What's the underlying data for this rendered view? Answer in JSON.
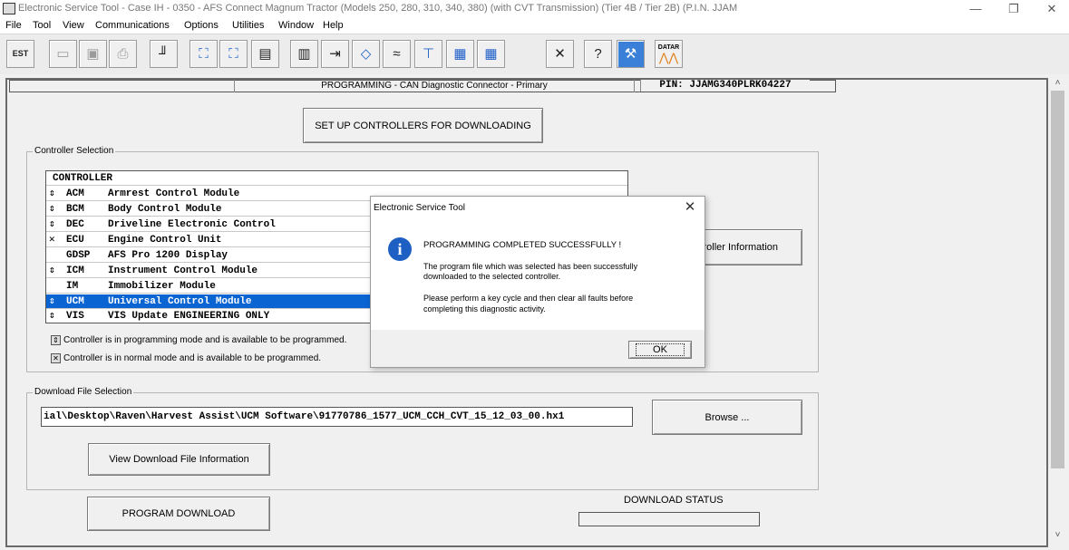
{
  "window": {
    "title": "Electronic Service Tool - Case IH - 0350 - AFS Connect Magnum Tractor (Models 250, 280, 310, 340, 380) (with CVT Transmission) (Tier 4B / Tier 2B) (P.I.N. JJAM",
    "minimize": "—",
    "restore": "❐",
    "close": "✕"
  },
  "menu": {
    "items": [
      {
        "label": "File"
      },
      {
        "label": "Tool"
      },
      {
        "label": "View"
      },
      {
        "label": "Communications"
      },
      {
        "label": "Options"
      },
      {
        "label": "Utilities"
      },
      {
        "label": "Window"
      },
      {
        "label": "Help"
      }
    ]
  },
  "toolbar": {
    "est_label": "EST",
    "datar_label": "DATAR",
    "buttons": [
      {
        "icon": "est-icon",
        "glyph": "⊟"
      },
      {
        "icon": "open-icon",
        "glyph": "📂"
      },
      {
        "icon": "save-icon",
        "glyph": "💾"
      },
      {
        "icon": "print-icon",
        "glyph": "🖶"
      },
      {
        "icon": "connector-icon",
        "glyph": "🔌"
      },
      {
        "icon": "network-icon",
        "glyph": "⛓"
      },
      {
        "icon": "network-compare-icon",
        "glyph": "⛓"
      },
      {
        "icon": "flash-icon",
        "glyph": "▤"
      },
      {
        "icon": "program-icon",
        "glyph": "▥"
      },
      {
        "icon": "wiring-icon",
        "glyph": "⇥"
      },
      {
        "icon": "diamond-icon",
        "glyph": "◇"
      },
      {
        "icon": "signal-icon",
        "glyph": "≈"
      },
      {
        "icon": "graph-icon",
        "glyph": "⊤"
      },
      {
        "icon": "modules-icon",
        "glyph": "▦"
      },
      {
        "icon": "modules2-icon",
        "glyph": "▦"
      },
      {
        "icon": "tools-icon",
        "glyph": "✕"
      },
      {
        "icon": "connector-help-icon",
        "glyph": "?"
      },
      {
        "icon": "wrench-icon",
        "glyph": "🔧"
      },
      {
        "icon": "datar-icon",
        "glyph": "〽"
      }
    ]
  },
  "header": {
    "title": "PROGRAMMING  -  CAN Diagnostic Connector - Primary",
    "pin": "PIN: JJAMG340PLRK04227"
  },
  "setup_button": "SET UP CONTROLLERS FOR DOWNLOADING",
  "controller_selection": {
    "group_label": "Controller Selection",
    "column_header": "CONTROLLER",
    "rows": [
      {
        "symbol": "⇕",
        "abbr": "ACM",
        "name": "Armrest Control Module",
        "selected": false
      },
      {
        "symbol": "⇕",
        "abbr": "BCM",
        "name": "Body Control Module",
        "selected": false
      },
      {
        "symbol": "⇕",
        "abbr": "DEC",
        "name": "Driveline Electronic Control",
        "selected": false
      },
      {
        "symbol": "✕",
        "abbr": "ECU",
        "name": "Engine Control Unit",
        "selected": false
      },
      {
        "symbol": "",
        "abbr": "GDSP",
        "name": "AFS Pro 1200 Display",
        "selected": false
      },
      {
        "symbol": "⇕",
        "abbr": "ICM",
        "name": "Instrument Control Module",
        "selected": false
      },
      {
        "symbol": "",
        "abbr": "IM",
        "name": "Immobilizer Module",
        "selected": false
      },
      {
        "symbol": "⇕",
        "abbr": "UCM",
        "name": "Universal Control Module",
        "selected": true
      },
      {
        "symbol": "⇕",
        "abbr": "VIS",
        "name": "VIS Update ENGINEERING ONLY",
        "selected": false
      }
    ],
    "legend_programming": "Controller is in programming mode and is available to be programmed.",
    "legend_normal": "Controller is in normal mode and is available to be programmed.",
    "legend_programming_icon": "⇕",
    "legend_normal_icon": "✕",
    "info_button": "ontroller Information"
  },
  "download_file": {
    "group_label": "Download File Selection",
    "path": "ial\\Desktop\\Raven\\Harvest Assist\\UCM Software\\91770786_1577_UCM_CCH_CVT_15_12_03_00.hx1",
    "browse_button": "Browse ...",
    "view_info_button": "View Download File Information"
  },
  "program_download_button": "PROGRAM DOWNLOAD",
  "download_status": {
    "label": "DOWNLOAD STATUS",
    "progress": 0
  },
  "dialog": {
    "title": "Electronic Service Tool",
    "close": "✕",
    "icon": "info-icon",
    "icon_glyph": "i",
    "heading": "PROGRAMMING COMPLETED SUCCESSFULLY !",
    "line1": "The program file which was selected has been successfully",
    "line2": "downloaded to the selected controller.",
    "line3": "Please perform a key cycle and then clear all faults before",
    "line4": "completing this diagnostic activity.",
    "ok": "OK"
  },
  "scroll": {
    "up": "˄",
    "down": "˅"
  },
  "colors": {
    "selection": "#0a64d2",
    "info_icon": "#1e5fc4",
    "toolbar_icon": "#1a4fb0"
  }
}
